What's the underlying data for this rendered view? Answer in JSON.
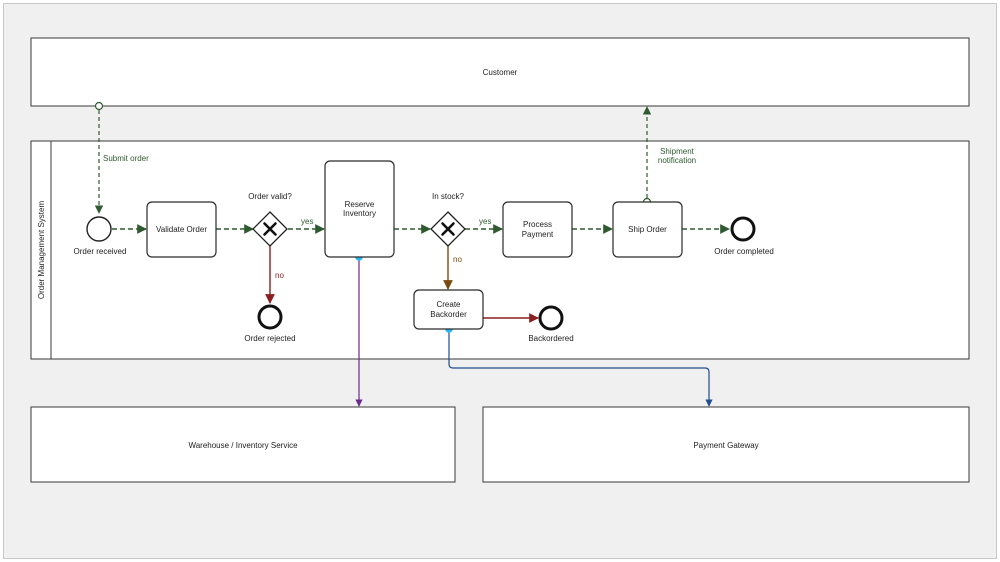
{
  "colors": {
    "sequence_flow": "#2f5a2f",
    "message_flow": "#2f5a2f",
    "reject_flow": "#8b1e1e",
    "backorder_flow": "#7a4a10",
    "backorder_end_flow": "#8b1e1e",
    "warehouse_link": "#6a2a8a",
    "payment_link": "#1f4e8c",
    "anchor_dot": "#29b6f6"
  },
  "pools": {
    "customer": "Customer",
    "order_system": "Order Management System",
    "warehouse": "Warehouse / Inventory Service",
    "payment_gateway": "Payment Gateway"
  },
  "events": {
    "order_received": "Order received",
    "order_rejected": "Order rejected",
    "backordered": "Backordered",
    "order_completed": "Order completed"
  },
  "tasks": {
    "validate_order": [
      "Validate Order"
    ],
    "reserve_inventory": [
      "Reserve",
      "Inventory"
    ],
    "process_payment": [
      "Process",
      "Payment"
    ],
    "ship_order": [
      "Ship Order"
    ],
    "create_backorder": [
      "Create",
      "Backorder"
    ]
  },
  "gateways": {
    "order_valid": "Order valid?",
    "in_stock": "In stock?"
  },
  "flow_labels": {
    "submit_order": "Submit order",
    "shipment_notification": [
      "Shipment",
      "notification"
    ],
    "valid_yes": "yes",
    "valid_no": "no",
    "stock_yes": "yes",
    "stock_no": "no"
  },
  "icons": {
    "gateway_marker": "x-mark-icon"
  }
}
